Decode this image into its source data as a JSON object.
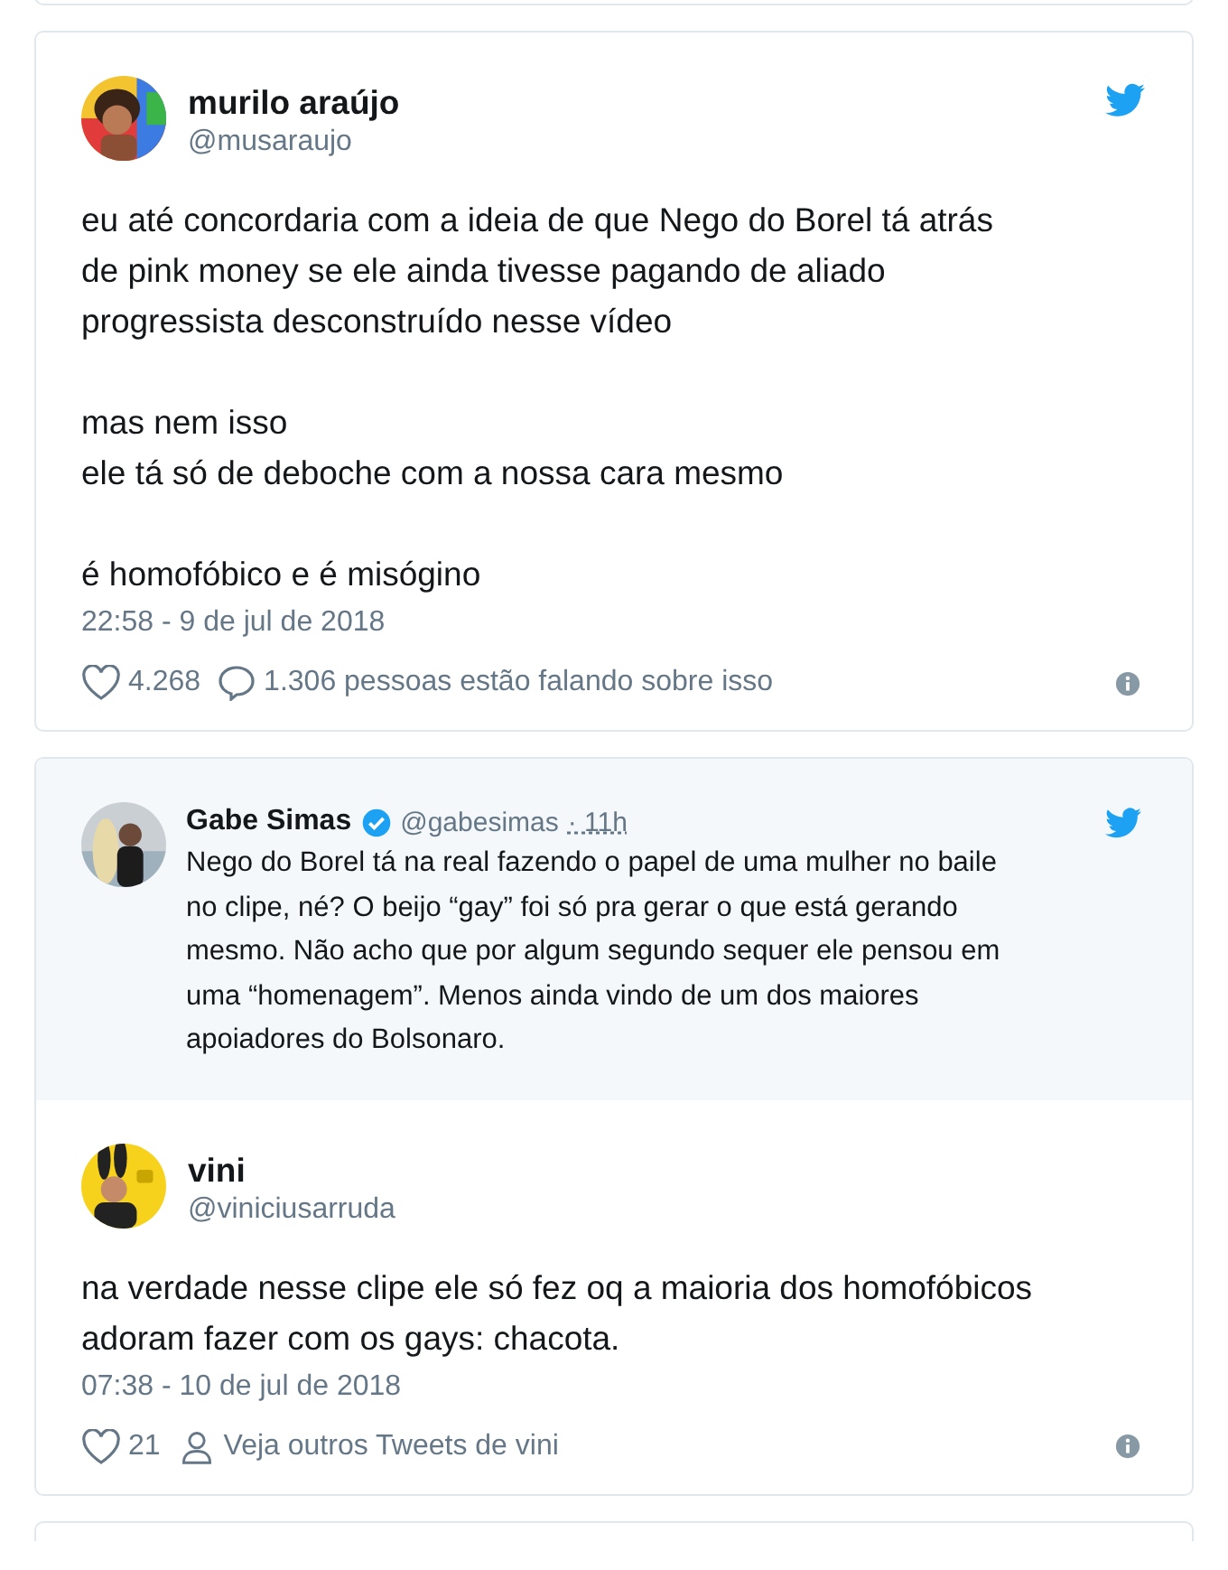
{
  "tweets": [
    {
      "name": "murilo araújo",
      "handle": "@musaraujo",
      "paragraphs": [
        [
          "eu até concordaria com a ideia de que Nego do Borel tá atrás",
          "de pink money se ele ainda tivesse pagando de aliado",
          "progressista desconstruído nesse vídeo"
        ],
        [
          "mas nem isso",
          "ele tá só de deboche com a nossa cara mesmo"
        ],
        [
          "é homofóbico e é misógino"
        ]
      ],
      "timestamp": "22:58 - 9 de jul de 2018",
      "likes": "4.268",
      "actions": [
        {
          "kind": "reply",
          "label": "1.306 pessoas estão falando sobre isso"
        }
      ]
    },
    {
      "quoted": {
        "name": "Gabe Simas",
        "verified": true,
        "handle": "@gabesimas",
        "time": "· 11h",
        "lines": [
          "Nego do Borel tá na real fazendo o papel de uma mulher no baile",
          "no clipe, né? O beijo “gay” foi só pra gerar o que está gerando",
          "mesmo. Não acho que por algum segundo sequer ele pensou em",
          "uma “homenagem”. Menos ainda vindo de um dos maiores",
          "apoiadores do Bolsonaro."
        ]
      },
      "name": "vini",
      "handle": "@viniciusarruda",
      "paragraphs": [
        [
          "na verdade nesse clipe ele só fez oq a maioria dos homofóbicos",
          "adoram fazer com os gays: chacota."
        ]
      ],
      "timestamp": "07:38 - 10 de jul de 2018",
      "likes": "21",
      "actions": [
        {
          "kind": "profile",
          "label": "Veja outros Tweets de vini"
        }
      ]
    }
  ]
}
